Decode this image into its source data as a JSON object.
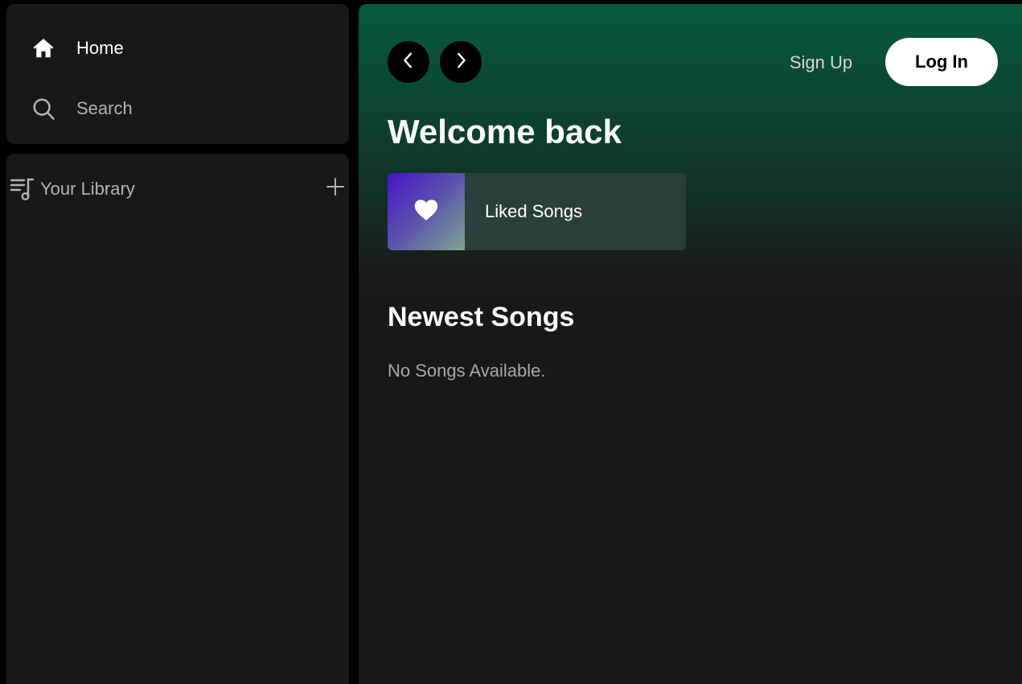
{
  "sidebar": {
    "nav": {
      "home": {
        "label": "Home",
        "icon": "home-icon"
      },
      "search": {
        "label": "Search",
        "icon": "search-icon"
      }
    },
    "library": {
      "label": "Your Library",
      "icon": "library-icon",
      "add_icon": "plus-icon"
    }
  },
  "header": {
    "back_icon": "chevron-left-icon",
    "forward_icon": "chevron-right-icon",
    "signup_label": "Sign Up",
    "login_label": "Log In"
  },
  "main": {
    "welcome": "Welcome back",
    "liked": {
      "label": "Liked Songs",
      "icon": "heart-icon"
    },
    "newest": {
      "title": "Newest Songs",
      "empty": "No Songs Available."
    }
  },
  "colors": {
    "background": "#000000",
    "panel": "#181818",
    "accent_green": "#075a40",
    "liked_card": "#2a3f39",
    "muted_text": "#b3b3b3"
  }
}
